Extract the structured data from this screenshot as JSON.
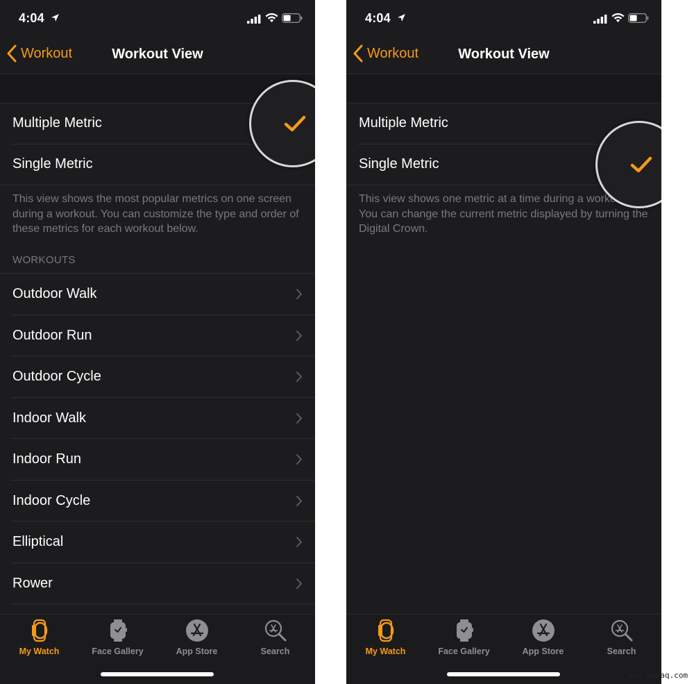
{
  "accent_color": "#f49a1b",
  "screens": [
    {
      "status_bar": {
        "time": "4:04"
      },
      "nav": {
        "back_label": "Workout",
        "title": "Workout View"
      },
      "options": [
        {
          "label": "Multiple Metric",
          "selected": true
        },
        {
          "label": "Single Metric",
          "selected": false
        }
      ],
      "footer": "This view shows the most popular metrics on one screen during a workout. You can customize the type and order of these metrics for each workout below.",
      "section_header": "WORKOUTS",
      "workouts": [
        "Outdoor Walk",
        "Outdoor Run",
        "Outdoor Cycle",
        "Indoor Walk",
        "Indoor Run",
        "Indoor Cycle",
        "Elliptical",
        "Rower"
      ],
      "tabs": [
        {
          "label": "My Watch",
          "icon": "my-watch-icon",
          "active": true
        },
        {
          "label": "Face Gallery",
          "icon": "face-gallery-icon",
          "active": false
        },
        {
          "label": "App Store",
          "icon": "app-store-icon",
          "active": false
        },
        {
          "label": "Search",
          "icon": "search-icon",
          "active": false
        }
      ]
    },
    {
      "status_bar": {
        "time": "4:04"
      },
      "nav": {
        "back_label": "Workout",
        "title": "Workout View"
      },
      "options": [
        {
          "label": "Multiple Metric",
          "selected": false
        },
        {
          "label": "Single Metric",
          "selected": true
        }
      ],
      "footer": "This view shows one metric at a time during a workout. You can change the current metric displayed by turning the Digital Crown.",
      "tabs": [
        {
          "label": "My Watch",
          "icon": "my-watch-icon",
          "active": true
        },
        {
          "label": "Face Gallery",
          "icon": "face-gallery-icon",
          "active": false
        },
        {
          "label": "App Store",
          "icon": "app-store-icon",
          "active": false
        },
        {
          "label": "Search",
          "icon": "search-icon",
          "active": false
        }
      ]
    }
  ],
  "watermark": "www.deuaq.com"
}
